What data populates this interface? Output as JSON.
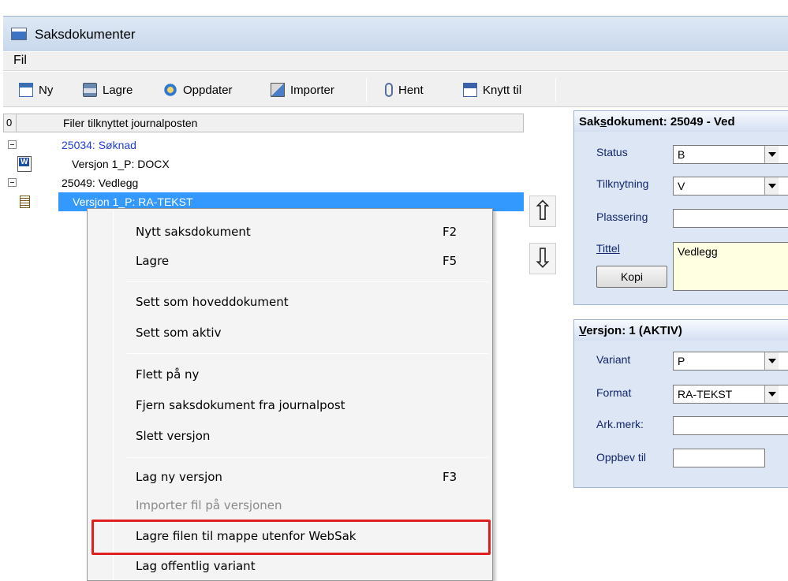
{
  "window": {
    "title": "Saksdokumenter"
  },
  "menubar": {
    "items": [
      "Fil"
    ]
  },
  "toolbar": {
    "ny": "Ny",
    "lagre": "Lagre",
    "oppdater": "Oppdater",
    "importer": "Importer",
    "hent": "Hent",
    "knytt_til": "Knytt til"
  },
  "tree": {
    "header_num": "0",
    "header_label": "Filer tilknyttet journalposten",
    "rows": [
      {
        "label": "25034: Søknad",
        "color": "#1f3fd6"
      },
      {
        "label": "Versjon 1_P: DOCX"
      },
      {
        "label": "25049: Vedlegg"
      },
      {
        "label": "Versjon 1_P: RA-TEKST"
      }
    ]
  },
  "arrows": {
    "up": "⇧",
    "down": "⇩"
  },
  "saksdokument": {
    "title_prefix": "Sak",
    "title_underlined": "s",
    "title_rest": "dokument: 25049 - Ved",
    "status_label": "Status",
    "status_value": "B",
    "tilknytning_label": "Tilknytning",
    "tilknytning_value": "V",
    "plassering_label": "Plassering",
    "plassering_value": "",
    "tittel_label": "Tittel",
    "tittel_value": "Vedlegg",
    "kopi_label": "Kopi"
  },
  "versjon": {
    "title_underlined": "V",
    "title_rest": "ersjon: 1 (AKTIV)",
    "variant_label": "Variant",
    "variant_value": "P",
    "format_label": "Format",
    "format_value": "RA-TEKST",
    "arkmerk_label": "Ark.merk:",
    "arkmerk_value": "",
    "oppbev_label": "Oppbev til",
    "oppbev_value": ""
  },
  "context_menu": {
    "items": [
      {
        "label": "Nytt saksdokument",
        "key": "F2"
      },
      {
        "label": "Lagre",
        "key": "F5"
      },
      {
        "label": "Sett som hoveddokument",
        "key": ""
      },
      {
        "label": "Sett som aktiv",
        "key": ""
      },
      {
        "label": "Flett på ny",
        "key": ""
      },
      {
        "label": "Fjern saksdokument fra journalpost",
        "key": ""
      },
      {
        "label": "Slett versjon",
        "key": ""
      },
      {
        "label": "Lag ny versjon",
        "key": "F3"
      },
      {
        "label": "Importer fil på versjonen",
        "key": "",
        "disabled": true
      },
      {
        "label": "Lagre filen til mappe utenfor WebSak",
        "key": ""
      },
      {
        "label": "Lag offentlig variant",
        "key": ""
      }
    ]
  },
  "colors": {
    "selection": "#3399ff",
    "highlight": "#e02020",
    "panel_bg": "#dce6f4"
  }
}
